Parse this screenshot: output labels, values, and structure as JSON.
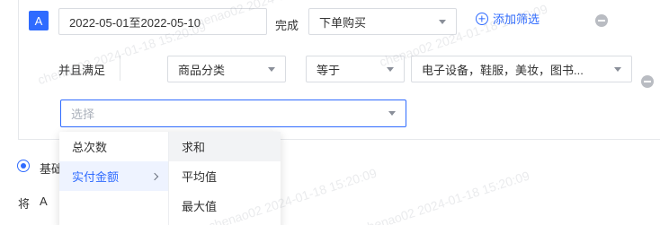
{
  "row1": {
    "badge": "A",
    "date_range": "2022-05-01至2022-05-10",
    "done_label": "完成",
    "event_select": "下单购买",
    "add_filter": "添加筛选"
  },
  "row2": {
    "and_label": "并且满足",
    "category_select": "商品分类",
    "operator_select": "等于",
    "values_select": "电子设备，鞋服，美妆，图书..."
  },
  "row3": {
    "choose_placeholder": "选择"
  },
  "dropdown": {
    "col1": [
      "总次数",
      "实付金额"
    ],
    "col2": [
      "求和",
      "平均值",
      "最大值"
    ]
  },
  "bottom": {
    "basic_label": "基础",
    "will_label": "将",
    "a_label": "A"
  },
  "watermark": "chenao02 2024-01-18 15:20:09",
  "colors": {
    "accent": "#2f6bff",
    "border": "#d9dce1"
  }
}
